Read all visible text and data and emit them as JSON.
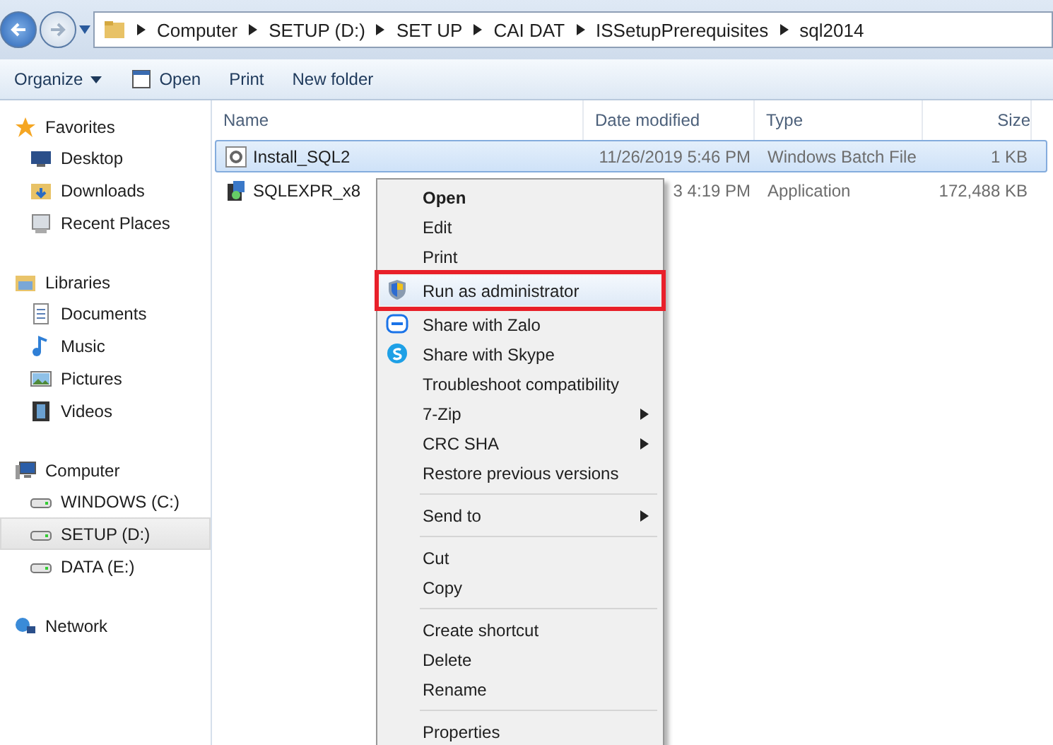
{
  "address_bar": {
    "path": [
      "Computer",
      "SETUP (D:)",
      "SET UP",
      "CAI DAT",
      "ISSetupPrerequisites",
      "sql2014"
    ]
  },
  "toolbar": [
    {
      "label": "Organize",
      "kind": "dropdown"
    },
    {
      "label": "Open",
      "kind": "icon"
    },
    {
      "label": "Print",
      "kind": "plain"
    },
    {
      "label": "New folder",
      "kind": "plain"
    }
  ],
  "sidebar": {
    "groups": [
      {
        "label": "Favorites",
        "items": [
          {
            "label": "Desktop",
            "selected": false
          },
          {
            "label": "Downloads",
            "selected": false
          },
          {
            "label": "Recent Places",
            "selected": false
          }
        ]
      },
      {
        "label": "Libraries",
        "items": [
          {
            "label": "Documents",
            "selected": false
          },
          {
            "label": "Music",
            "selected": false
          },
          {
            "label": "Pictures",
            "selected": false
          },
          {
            "label": "Videos",
            "selected": false
          }
        ]
      },
      {
        "label": "Computer",
        "items": [
          {
            "label": "WINDOWS (C:)",
            "selected": false
          },
          {
            "label": "SETUP (D:)",
            "selected": true
          },
          {
            "label": "DATA (E:)",
            "selected": false
          }
        ]
      },
      {
        "label": "Network"
      }
    ]
  },
  "table": {
    "columns": [
      "Name",
      "Date modified",
      "Type",
      "Size"
    ],
    "rows": [
      {
        "name": "Install_SQL2",
        "date": "11/26/2019 5:46 PM",
        "type": "Windows Batch File",
        "size": "1 KB",
        "selected": true
      },
      {
        "name": "SQLEXPR_x8",
        "date": "3 4:19 PM",
        "type": "Application",
        "size": "172,488 KB",
        "selected": false
      }
    ]
  },
  "context_menu": {
    "items": [
      {
        "label": "Open",
        "kind": "item",
        "bold": true,
        "highlighted": false
      },
      {
        "label": "Edit",
        "kind": "item",
        "bold": false,
        "highlighted": false
      },
      {
        "label": "Print",
        "kind": "item",
        "bold": false,
        "highlighted": false
      },
      {
        "label": "Run as administrator",
        "kind": "item",
        "bold": false,
        "highlighted": true
      },
      {
        "label": "Share with Zalo",
        "kind": "item",
        "bold": false,
        "highlighted": false
      },
      {
        "label": "Share with Skype",
        "kind": "item",
        "bold": false,
        "highlighted": false
      },
      {
        "label": "Troubleshoot compatibility",
        "kind": "item",
        "bold": false,
        "highlighted": false
      },
      {
        "label": "7-Zip",
        "kind": "submenu",
        "bold": false,
        "highlighted": false
      },
      {
        "label": "CRC SHA",
        "kind": "submenu",
        "bold": false,
        "highlighted": false
      },
      {
        "label": "Restore previous versions",
        "kind": "item",
        "bold": false,
        "highlighted": false
      },
      {
        "kind": "separator"
      },
      {
        "label": "Send to",
        "kind": "submenu",
        "bold": false,
        "highlighted": false
      },
      {
        "kind": "separator"
      },
      {
        "label": "Cut",
        "kind": "item",
        "bold": false,
        "highlighted": false
      },
      {
        "label": "Copy",
        "kind": "item",
        "bold": false,
        "highlighted": false
      },
      {
        "kind": "separator"
      },
      {
        "label": "Create shortcut",
        "kind": "item",
        "bold": false,
        "highlighted": false
      },
      {
        "label": "Delete",
        "kind": "item",
        "bold": false,
        "highlighted": false
      },
      {
        "label": "Rename",
        "kind": "item",
        "bold": false,
        "highlighted": false
      },
      {
        "kind": "separator"
      },
      {
        "label": "Properties",
        "kind": "item",
        "bold": false,
        "highlighted": false
      }
    ]
  }
}
